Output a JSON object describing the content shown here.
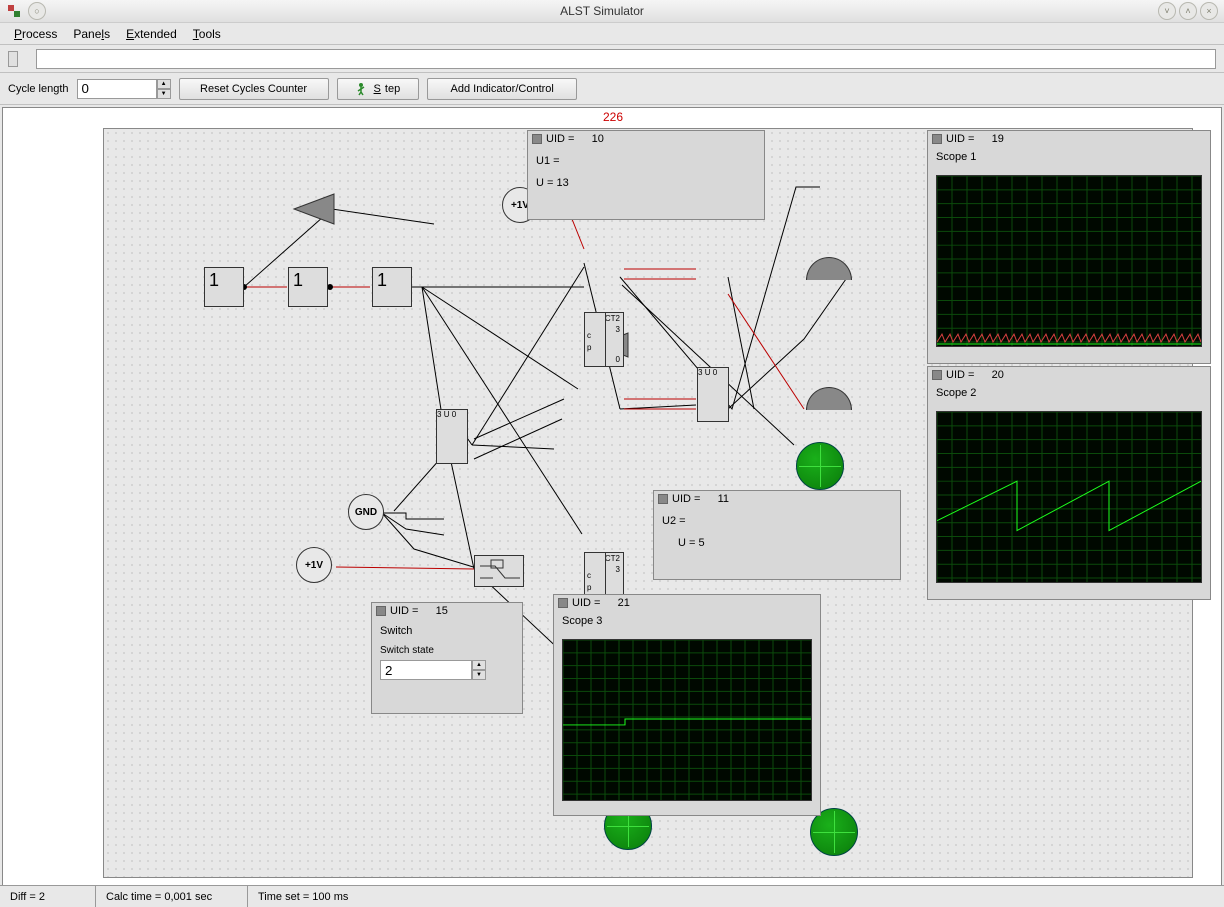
{
  "window": {
    "title": "ALST Simulator"
  },
  "menu": {
    "process": "Process",
    "panels": "Panels",
    "extended": "Extended",
    "tools": "Tools"
  },
  "toolbar": {
    "cycle_length_label": "Cycle length",
    "cycle_length_value": "0",
    "reset_label": "Reset Cycles Counter",
    "step_label": "Step",
    "add_indicator_label": "Add Indicator/Control"
  },
  "canvas": {
    "counter": "226",
    "logic1": "1",
    "logic2": "1",
    "logic3": "1",
    "gnd_label": "GND",
    "plus1v_label_a": "+1V",
    "plus1v_label_b": "+1V",
    "ct2_label": "CT2",
    "box_top_num": "3",
    "box_bot_num": "0",
    "box_p": "p",
    "box_c": "c",
    "box_U": "U"
  },
  "panels": {
    "p10": {
      "uid_label": "UID =",
      "uid": "10",
      "u1_label": "U1 =",
      "u_value": "U = 13"
    },
    "p11": {
      "uid_label": "UID =",
      "uid": "11",
      "u2_label": "U2 =",
      "u_value": "U = 5"
    },
    "p15": {
      "uid_label": "UID =",
      "uid": "15",
      "title": "Switch",
      "state_label": "Switch state",
      "state_value": "2"
    },
    "p19": {
      "uid_label": "UID =",
      "uid": "19",
      "title": "Scope 1"
    },
    "p20": {
      "uid_label": "UID =",
      "uid": "20",
      "title": "Scope 2"
    },
    "p21": {
      "uid_label": "UID =",
      "uid": "21",
      "title": "Scope 3"
    }
  },
  "status": {
    "diff": "Diff = 2",
    "calc": "Calc time = 0,001 sec",
    "timeset": "Time set = 100 ms"
  }
}
